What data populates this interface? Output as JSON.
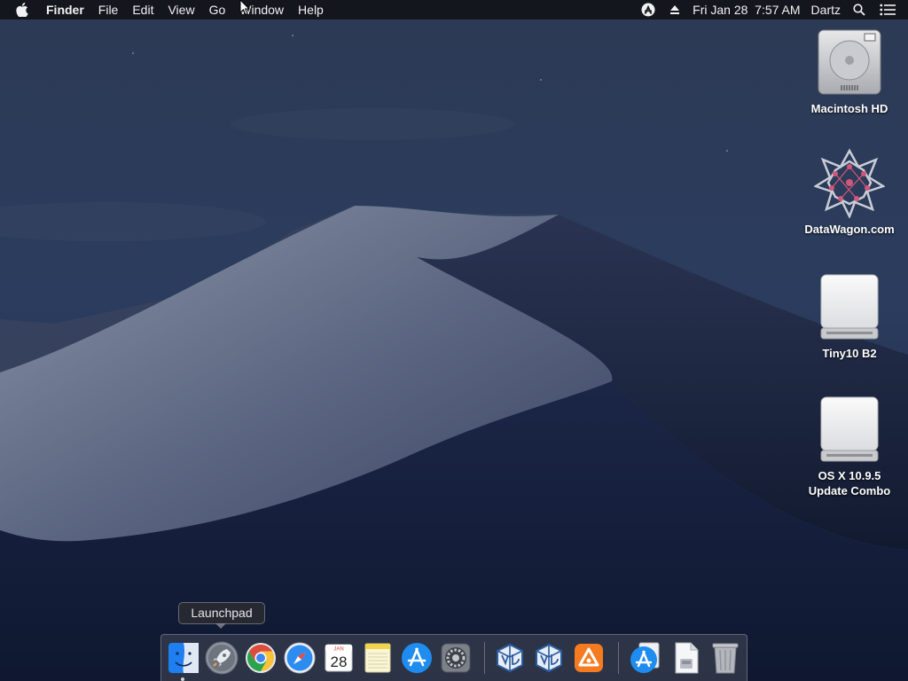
{
  "menubar": {
    "apple_icon": "apple-logo-icon",
    "app_name": "Finder",
    "menus": [
      "File",
      "Edit",
      "View",
      "Go",
      "Window",
      "Help"
    ],
    "status": {
      "accessibility_icon": "accessibility-icon",
      "eject_icon": "eject-icon",
      "datetime": "Fri Jan 28  7:57 AM",
      "user": "Dartz",
      "spotlight_icon": "search-icon",
      "notification_icon": "notification-center-icon"
    }
  },
  "desktop": {
    "icons": [
      {
        "label": "Macintosh HD",
        "icon": "hard-drive-icon"
      },
      {
        "label": "DataWagon.com",
        "icon": "datawagon-icon"
      },
      {
        "label": "Tiny10 B2",
        "icon": "external-drive-icon"
      },
      {
        "label": "OS X 10.9.5\nUpdate Combo",
        "icon": "disk-image-icon"
      }
    ]
  },
  "tooltip": {
    "label": "Launchpad"
  },
  "dock": {
    "items": [
      {
        "icon": "finder-icon",
        "running": true
      },
      {
        "icon": "launchpad-icon",
        "running": false
      },
      {
        "icon": "chrome-icon",
        "running": false
      },
      {
        "icon": "safari-icon",
        "running": false
      },
      {
        "icon": "calendar-icon",
        "running": false,
        "month": "JAN",
        "day": "28"
      },
      {
        "icon": "notes-icon",
        "running": false
      },
      {
        "icon": "app-store-icon",
        "running": false
      },
      {
        "icon": "system-preferences-icon",
        "running": false
      },
      {
        "icon": "virtualbox-icon",
        "running": false
      },
      {
        "icon": "virtualbox-icon",
        "running": false
      },
      {
        "icon": "avast-icon",
        "running": false
      },
      {
        "icon": "app-store-downloads-icon",
        "running": false
      },
      {
        "icon": "document-stack-icon",
        "running": false
      },
      {
        "icon": "trash-icon",
        "running": false
      }
    ]
  }
}
